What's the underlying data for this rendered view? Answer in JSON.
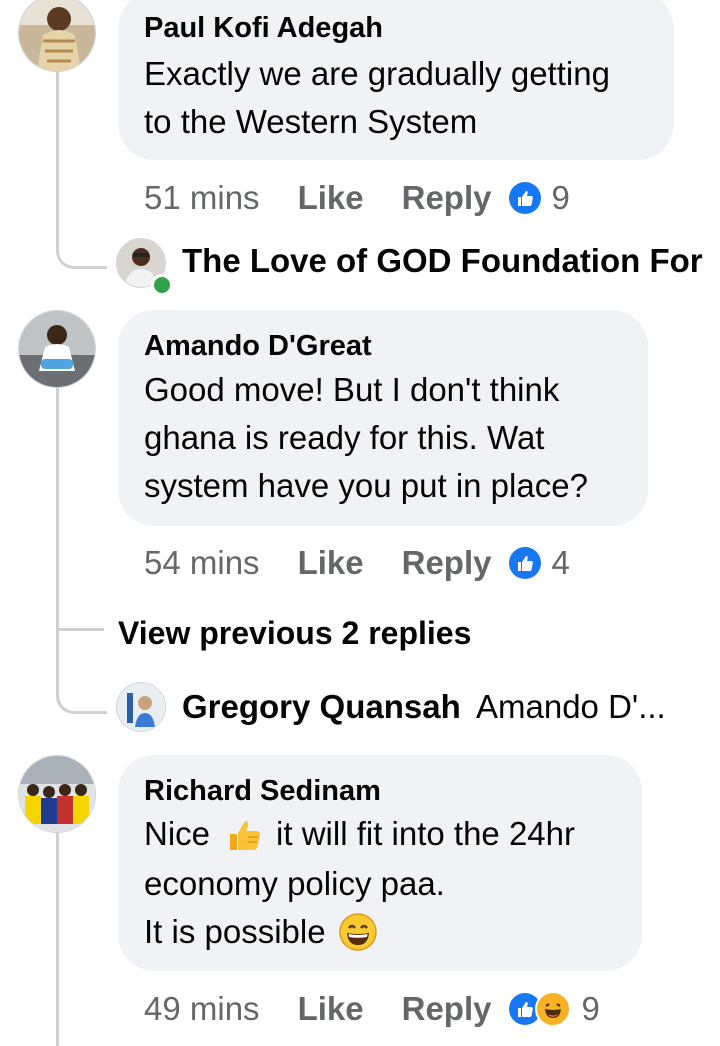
{
  "comments": [
    {
      "author": "Paul Kofi Adegah",
      "text_lines": [
        "Exactly we are gradually getting",
        "to the Western System"
      ],
      "time": "51 mins",
      "like_label": "Like",
      "reply_label": "Reply",
      "reaction_count": "9",
      "reactions": [
        "like-icon"
      ]
    },
    {
      "author": "Amando D'Great",
      "text_lines": [
        "Good move! But I don't think",
        "ghana is ready for this. Wat",
        "system have you put in place?"
      ],
      "time": "54 mins",
      "like_label": "Like",
      "reply_label": "Reply",
      "reaction_count": "4",
      "reactions": [
        "like-icon"
      ]
    },
    {
      "author": "Richard Sedinam",
      "text_lines": [
        "Nice",
        "it will fit into the 24hr",
        "economy policy paa.",
        "It is possible"
      ],
      "emojis": [
        "thumbs-up-emoji",
        "grinning-face-emoji"
      ],
      "time": "49 mins",
      "like_label": "Like",
      "reply_label": "Reply",
      "reaction_count": "9",
      "reactions": [
        "like-icon",
        "haha-icon"
      ]
    }
  ],
  "replies": [
    {
      "author": "The Love of GOD Foundation For",
      "preview": "",
      "online": true
    },
    {
      "author": "Gregory Quansah",
      "preview": "Amando D'..."
    }
  ],
  "view_previous": "View previous 2 replies",
  "colors": {
    "bubble": "#f0f2f5",
    "meta": "#65676b",
    "like_blue": "#1877f2",
    "online": "#31a24c",
    "thread_line": "#ced0d4"
  }
}
